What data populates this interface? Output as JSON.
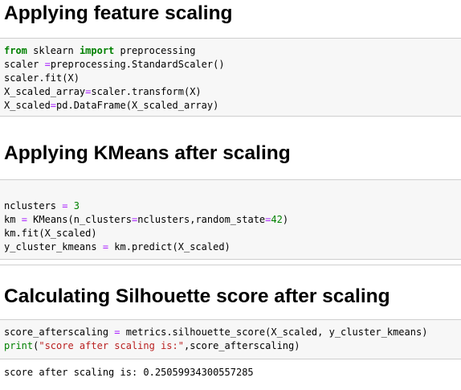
{
  "sections": [
    {
      "heading": "Applying feature scaling",
      "code": [
        [
          {
            "t": "from",
            "c": "kw"
          },
          {
            "t": " sklearn ",
            "c": ""
          },
          {
            "t": "import",
            "c": "kw"
          },
          {
            "t": " preprocessing",
            "c": ""
          }
        ],
        [
          {
            "t": "scaler ",
            "c": ""
          },
          {
            "t": "=",
            "c": "op"
          },
          {
            "t": "preprocessing.StandardScaler()",
            "c": ""
          }
        ],
        [
          {
            "t": "scaler.fit(X)",
            "c": ""
          }
        ],
        [
          {
            "t": "X_scaled_array",
            "c": ""
          },
          {
            "t": "=",
            "c": "op"
          },
          {
            "t": "scaler.transform(X)",
            "c": ""
          }
        ],
        [
          {
            "t": "X_scaled",
            "c": ""
          },
          {
            "t": "=",
            "c": "op"
          },
          {
            "t": "pd.DataFrame(X_scaled_array)",
            "c": ""
          }
        ]
      ]
    },
    {
      "heading": "Applying KMeans after scaling",
      "code": [
        [],
        [
          {
            "t": "nclusters ",
            "c": ""
          },
          {
            "t": "=",
            "c": "op"
          },
          {
            "t": " ",
            "c": ""
          },
          {
            "t": "3",
            "c": "num"
          }
        ],
        [
          {
            "t": "km ",
            "c": ""
          },
          {
            "t": "=",
            "c": "op"
          },
          {
            "t": " KMeans(n_clusters",
            "c": ""
          },
          {
            "t": "=",
            "c": "op"
          },
          {
            "t": "nclusters,random_state",
            "c": ""
          },
          {
            "t": "=",
            "c": "op"
          },
          {
            "t": "42",
            "c": "num"
          },
          {
            "t": ")",
            "c": ""
          }
        ],
        [
          {
            "t": "km.fit(X_scaled)",
            "c": ""
          }
        ],
        [
          {
            "t": "y_cluster_kmeans ",
            "c": ""
          },
          {
            "t": "=",
            "c": "op"
          },
          {
            "t": " km.predict(X_scaled)",
            "c": ""
          }
        ]
      ]
    },
    {
      "heading": "Calculating Silhouette score after scaling",
      "code": [
        [
          {
            "t": "score_afterscaling ",
            "c": ""
          },
          {
            "t": "=",
            "c": "op"
          },
          {
            "t": " metrics.silhouette_score(X_scaled, y_cluster_kmeans)",
            "c": ""
          }
        ],
        [
          {
            "t": "print",
            "c": "bi"
          },
          {
            "t": "(",
            "c": ""
          },
          {
            "t": "\"score after scaling is:\"",
            "c": "str"
          },
          {
            "t": ",score_afterscaling)",
            "c": ""
          }
        ]
      ],
      "output": "score after scaling is: 0.25059934300557285"
    }
  ]
}
